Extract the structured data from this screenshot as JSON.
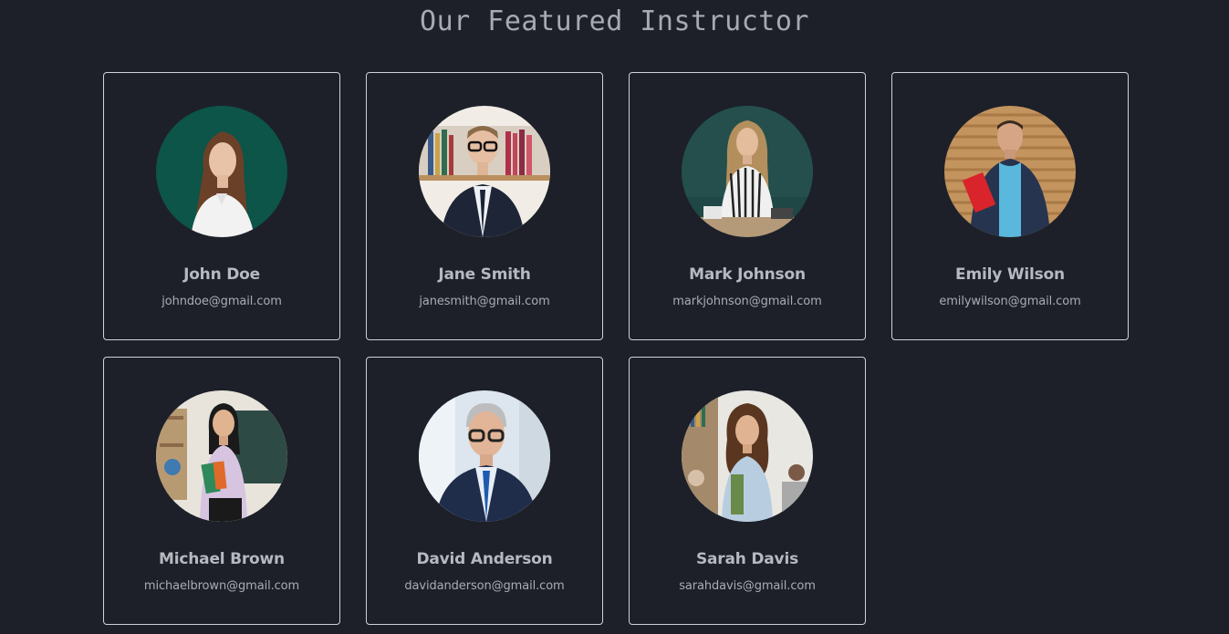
{
  "page": {
    "title": "Our Featured Instructor"
  },
  "colors": {
    "background": "#1d2029",
    "card_border": "#cfd2d8",
    "text": "#b6b9c0"
  },
  "instructors": [
    {
      "name": "John Doe",
      "email": "johndoe@gmail.com",
      "icon": "instructor-photo-icon"
    },
    {
      "name": "Jane Smith",
      "email": "janesmith@gmail.com",
      "icon": "instructor-photo-icon"
    },
    {
      "name": "Mark Johnson",
      "email": "markjohnson@gmail.com",
      "icon": "instructor-photo-icon"
    },
    {
      "name": "Emily Wilson",
      "email": "emilywilson@gmail.com",
      "icon": "instructor-photo-icon"
    },
    {
      "name": "Michael Brown",
      "email": "michaelbrown@gmail.com",
      "icon": "instructor-photo-icon"
    },
    {
      "name": "David Anderson",
      "email": "davidanderson@gmail.com",
      "icon": "instructor-photo-icon"
    },
    {
      "name": "Sarah Davis",
      "email": "sarahdavis@gmail.com",
      "icon": "instructor-photo-icon"
    }
  ]
}
